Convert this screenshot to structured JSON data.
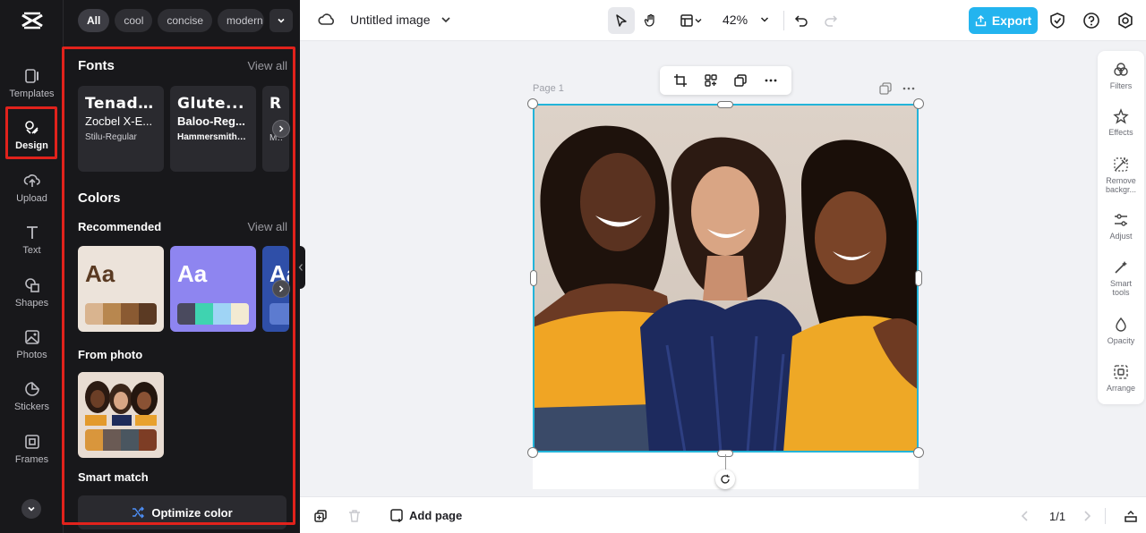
{
  "rail": {
    "items": [
      {
        "label": "Templates"
      },
      {
        "label": "Design"
      },
      {
        "label": "Upload"
      },
      {
        "label": "Text"
      },
      {
        "label": "Shapes"
      },
      {
        "label": "Photos"
      },
      {
        "label": "Stickers"
      },
      {
        "label": "Frames"
      }
    ],
    "active": "Design"
  },
  "panel": {
    "chips": [
      "All",
      "cool",
      "concise",
      "modern"
    ],
    "fonts": {
      "title": "Fonts",
      "view_all": "View all",
      "cards": [
        {
          "l1": "Tenada-...",
          "l2": "Zocbel X-E...",
          "l3": "Stilu-Regular"
        },
        {
          "l1": "Glute...",
          "l2": "Baloo-Reg...",
          "l3": "HammersmithOn..."
        },
        {
          "l1": "Ru",
          "l2": "",
          "l3": "Mon"
        }
      ]
    },
    "colors": {
      "title": "Colors",
      "recommended": "Recommended",
      "view_all": "View all",
      "aa": "Aa",
      "palettes": [
        {
          "bg": "#ece3da",
          "text": "#5a3a22",
          "swatches": [
            "#d9b48f",
            "#b8874f",
            "#8a5a32",
            "#5b3a23"
          ]
        },
        {
          "bg": "#8e85f0",
          "text": "#ffffff",
          "swatches": [
            "#4a4a5e",
            "#3fd3b0",
            "#9fd4f5",
            "#f3ead2"
          ]
        },
        {
          "bg": "#2f4fa8",
          "text": "#ffffff",
          "swatches": [
            "#5c7bd0"
          ]
        }
      ]
    },
    "from_photo": {
      "title": "From photo",
      "swatches": [
        "#d9963c",
        "#6a5a54",
        "#4a5660",
        "#7d3d25"
      ]
    },
    "smart_match": {
      "title": "Smart match",
      "button": "Optimize color"
    }
  },
  "topbar": {
    "title": "Untitled image",
    "zoom": "42%",
    "export": "Export"
  },
  "canvas": {
    "page_label": "Page 1"
  },
  "right_tools": [
    {
      "label": "Filters",
      "icon": "filters-icon"
    },
    {
      "label": "Effects",
      "icon": "effects-icon"
    },
    {
      "label": "Remove backgr...",
      "icon": "remove-background-icon"
    },
    {
      "label": "Adjust",
      "icon": "adjust-icon"
    },
    {
      "label": "Smart tools",
      "icon": "smart-tools-icon"
    },
    {
      "label": "Opacity",
      "icon": "opacity-icon"
    },
    {
      "label": "Arrange",
      "icon": "arrange-icon"
    }
  ],
  "bottombar": {
    "add_page": "Add page",
    "pages": "1/1"
  },
  "colors": {
    "accent": "#23b4ef",
    "highlight": "#e1221c",
    "dark": "#18181b"
  }
}
